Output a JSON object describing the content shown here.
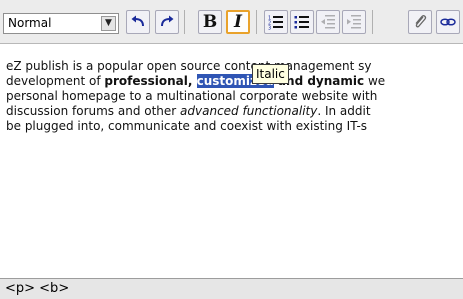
{
  "toolbar": {
    "style_select": {
      "value": "Normal",
      "arrow_icon": "dropdown-arrow-icon"
    },
    "buttons": {
      "undo": {
        "icon": "undo-icon"
      },
      "redo": {
        "icon": "redo-icon"
      },
      "bold": {
        "label": "B"
      },
      "italic": {
        "label": "I",
        "active": true
      },
      "ordered_list": {
        "icon": "ordered-list-icon"
      },
      "bullet_list": {
        "icon": "bullet-list-icon"
      },
      "outdent": {
        "icon": "outdent-icon",
        "disabled": true
      },
      "indent": {
        "icon": "indent-icon",
        "disabled": true
      },
      "attachment": {
        "icon": "paperclip-icon"
      },
      "link": {
        "icon": "link-icon"
      }
    }
  },
  "tooltip": {
    "text": "Italic"
  },
  "content": {
    "line1": {
      "text": "eZ publish is a popular open source content management sy"
    },
    "line2": {
      "prefix": "development of ",
      "bold1": "professional",
      "comma": ", ",
      "selected": "customized",
      "space": " ",
      "bold2": "and dynamic",
      "suffix": " we"
    },
    "line3": {
      "text": "personal homepage to a multinational corporate website with"
    },
    "line4": {
      "prefix": "discussion forums and other ",
      "italic": "advanced functionality",
      "suffix": ". In addit"
    },
    "line5": {
      "text": "be plugged into, communicate and coexist with existing IT-s"
    }
  },
  "statusbar": {
    "path": "<p> <b>"
  },
  "colors": {
    "toolbar_bg": "#ececec",
    "active_border": "#e9a22b",
    "selection_bg": "#2f55b4",
    "tooltip_bg": "#ffffe1",
    "statusbar_bg": "#e6e6e6"
  }
}
